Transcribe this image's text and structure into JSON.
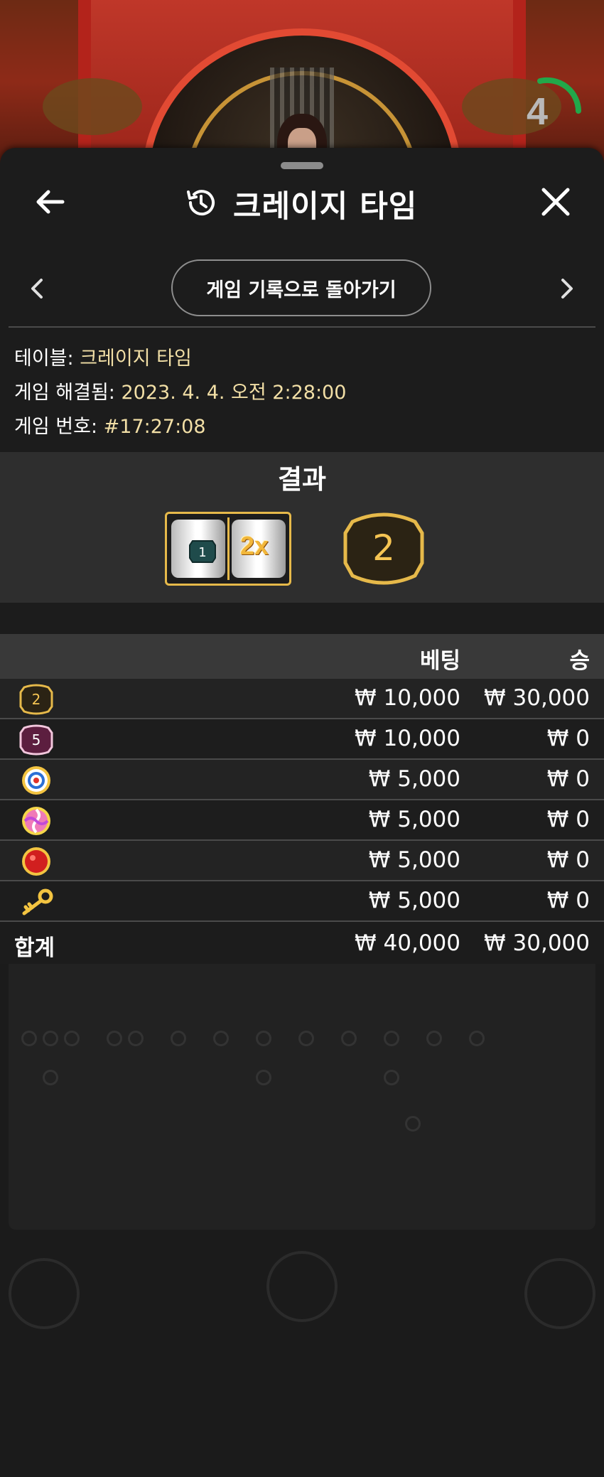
{
  "game_view": {
    "timer": "4"
  },
  "header": {
    "title": "크레이지 타임"
  },
  "nav": {
    "back_to_history": "게임 기록으로 돌아가기"
  },
  "meta": {
    "table_label": "테이블:",
    "table_value": "크레이지 타임",
    "resolved_label": "게임 해결됨:",
    "resolved_value": "2023. 4. 4. 오전 2:28:00",
    "game_no_label": "게임 번호:",
    "game_no_value": "#17:27:08"
  },
  "result": {
    "title": "결과",
    "slot_left_number": "1",
    "slot_right_multiplier": "2x",
    "outcome": "2"
  },
  "bets_table": {
    "col_bet": "베팅",
    "col_win": "승",
    "rows": [
      {
        "icon": "number-2-tile-icon",
        "label": "2",
        "bet": "₩ 10,000",
        "win": "₩ 30,000"
      },
      {
        "icon": "number-5-tile-icon",
        "label": "5",
        "bet": "₩ 10,000",
        "win": "₩ 0"
      },
      {
        "icon": "coin-flip-target-icon",
        "bet": "₩ 5,000",
        "win": "₩ 0"
      },
      {
        "icon": "pachinko-candy-icon",
        "bet": "₩ 5,000",
        "win": "₩ 0"
      },
      {
        "icon": "cash-hunt-red-button-icon",
        "bet": "₩ 5,000",
        "win": "₩ 0"
      },
      {
        "icon": "crazy-time-key-icon",
        "bet": "₩ 5,000",
        "win": "₩ 0"
      }
    ],
    "total_label": "합계",
    "total_bet": "₩ 40,000",
    "total_win": "₩ 30,000"
  },
  "colors": {
    "gold": "#e6b94a",
    "meta_value": "#f2dfa6",
    "sheet_bg": "#1c1c1c"
  }
}
